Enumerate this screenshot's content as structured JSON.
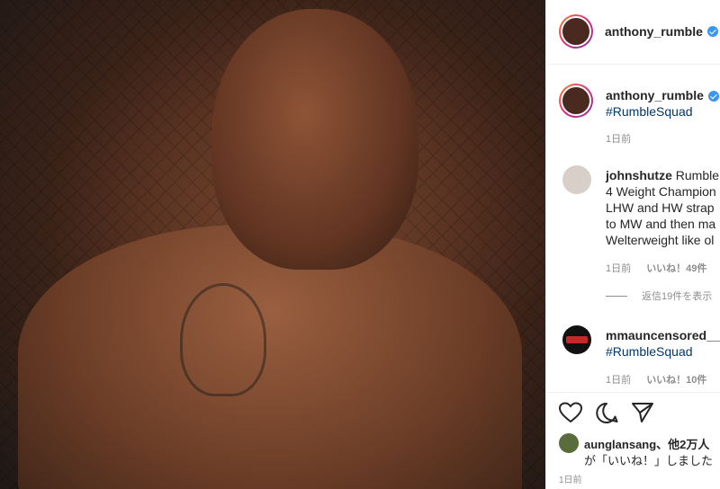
{
  "header": {
    "username": "anthony_rumble",
    "separator": "•"
  },
  "caption": {
    "username": "anthony_rumble",
    "hashtag": "#RumbleSquad",
    "time": "1日前"
  },
  "comments": [
    {
      "username": "johnshutze",
      "lines": [
        "Rumble",
        "4 Weight Champion",
        "LHW and HW strap",
        "to MW and then ma",
        "Welterweight like ol"
      ],
      "time": "1日前",
      "likes": "いいね！49件",
      "view_replies": "返信19件を表示"
    },
    {
      "username": "mmauncensored__",
      "hashtag": "#RumbleSquad",
      "time": "1日前",
      "likes": "いいね！10件"
    }
  ],
  "actions": {
    "like_icon": "heart-icon",
    "comment_icon": "comment-icon",
    "share_icon": "share-icon"
  },
  "liked_by": {
    "text": "aunglansang、他2万人",
    "text2": "が「いいね！」しました"
  },
  "post_time": "1日前",
  "colors": {
    "verified": "#3897f0",
    "hashtag": "#00376b",
    "meta": "#8e8e8e"
  }
}
